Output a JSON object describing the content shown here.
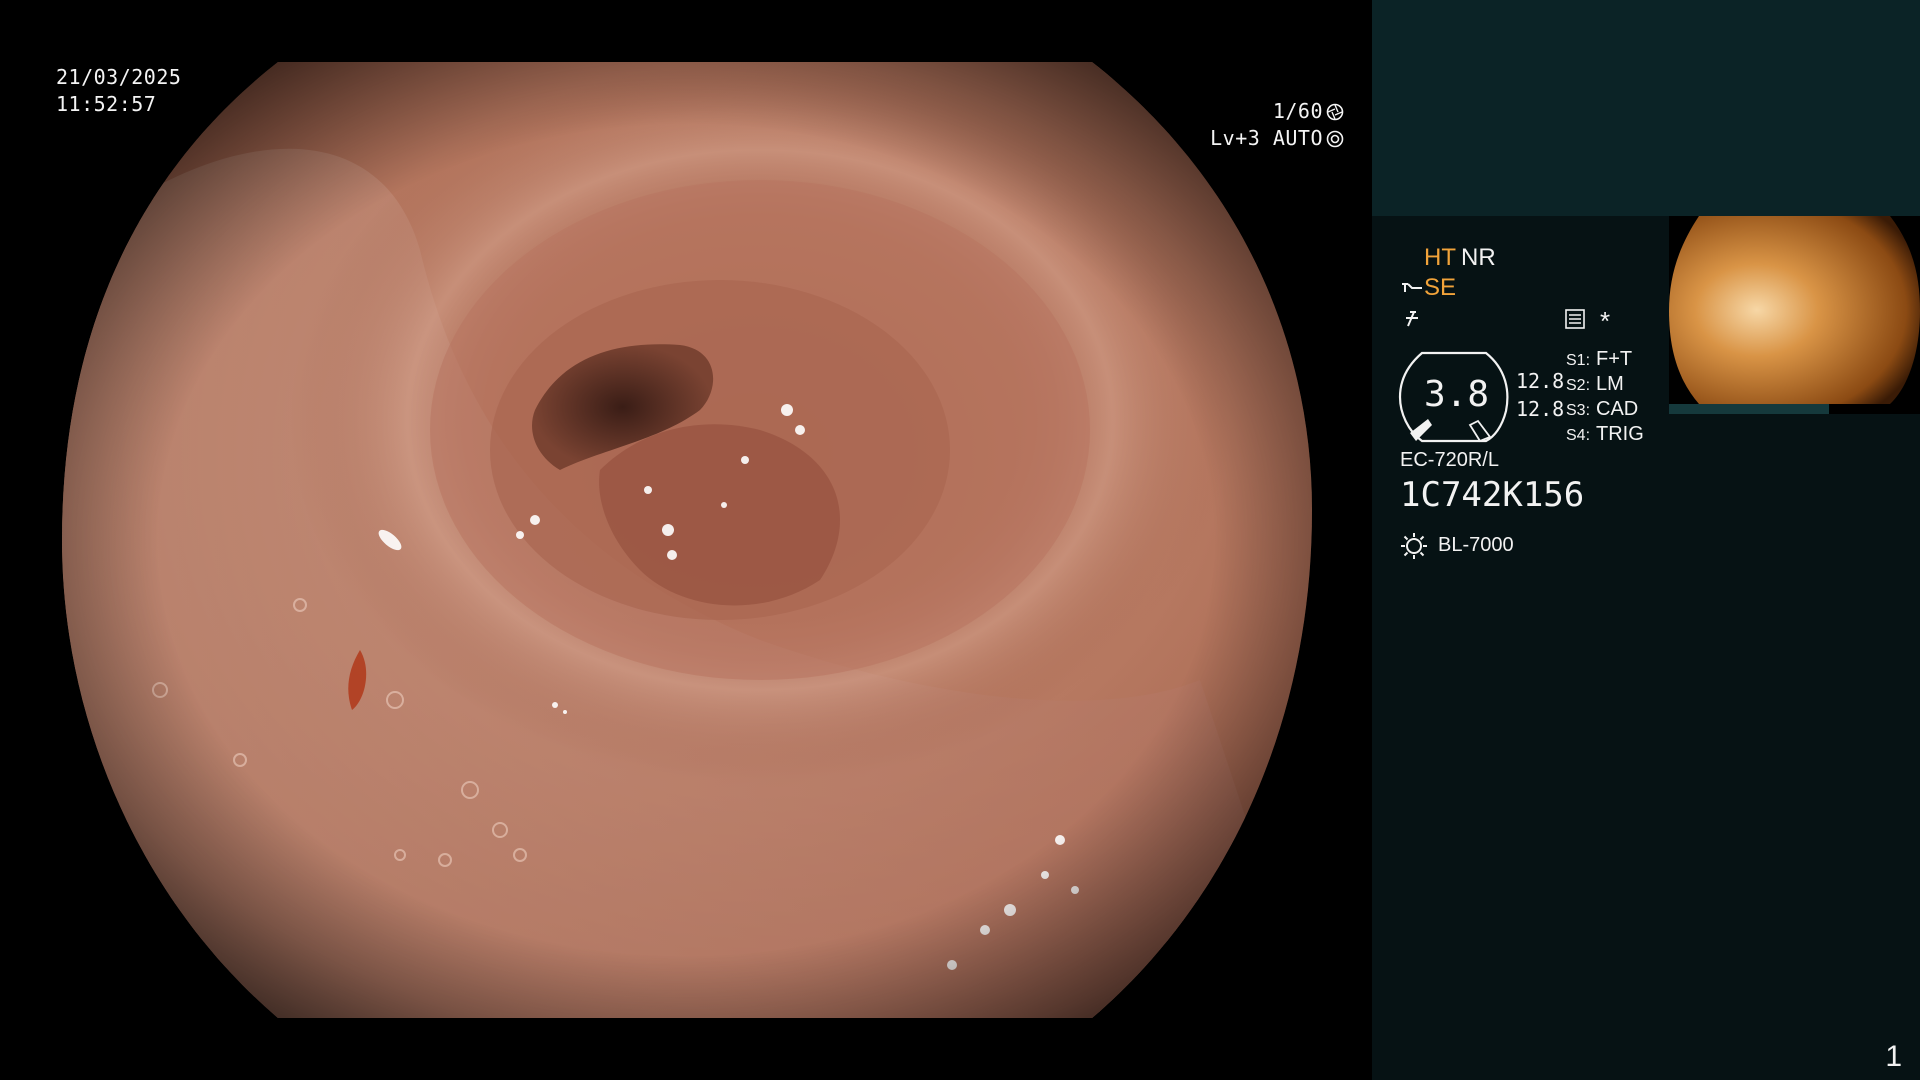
{
  "osd": {
    "date": "21/03/2025",
    "time": "11:52:57",
    "shutter": "1/60",
    "iris": "Lv+3 AUTO"
  },
  "panel": {
    "enhancement": "HT",
    "noise_reduction": "NR",
    "structure_enhancement": "SE",
    "gauge_value": "3.8",
    "gauge_left_value": "12.8",
    "gauge_right_value": "12.8",
    "asterisk": "*",
    "switches": [
      {
        "key": "S1:",
        "value": "F+T"
      },
      {
        "key": "S2:",
        "value": "LM"
      },
      {
        "key": "S3:",
        "value": "CAD"
      },
      {
        "key": "S4:",
        "value": "TRIG"
      }
    ],
    "scope_model": "EC-720R/L",
    "scope_serial": "1C742K156",
    "light_source": "BL-7000",
    "frame_number": "1"
  },
  "icons": {
    "shutter": "aperture-icon",
    "iris": "iris-icon",
    "structure": "structure-enhancement-icon",
    "color": "color-mode-icon",
    "record": "settings-card-icon",
    "light": "lamp-icon"
  },
  "colors": {
    "panel_background": "#061214",
    "panel_top_background": "#0b2326",
    "accent_orange": "#f1a33a",
    "text_white": "#f2f2f2"
  }
}
